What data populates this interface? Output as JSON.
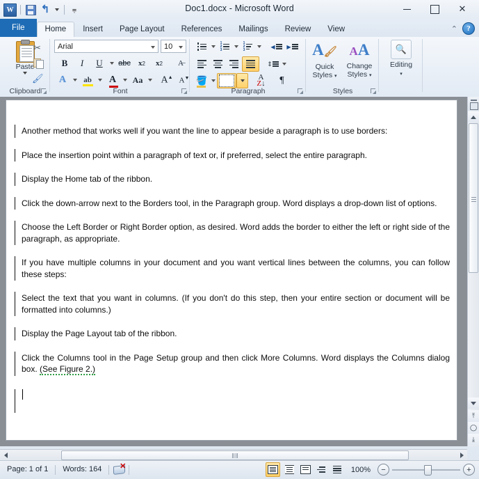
{
  "window": {
    "title": "Doc1.docx  -  Microsoft Word",
    "minimize_label": "Minimize",
    "maximize_label": "Maximize",
    "close_label": "✕"
  },
  "quick_access": {
    "app_logo": "W",
    "items": [
      {
        "name": "save",
        "label": "Save"
      },
      {
        "name": "undo",
        "label": "Undo",
        "glyph": "↰"
      },
      {
        "name": "customize",
        "label": "Customize Quick Access Toolbar"
      }
    ]
  },
  "ribbon": {
    "tabs": [
      {
        "label": "File",
        "active": false,
        "file": true
      },
      {
        "label": "Home",
        "active": true
      },
      {
        "label": "Insert",
        "active": false
      },
      {
        "label": "Page Layout",
        "active": false
      },
      {
        "label": "References",
        "active": false
      },
      {
        "label": "Mailings",
        "active": false
      },
      {
        "label": "Review",
        "active": false
      },
      {
        "label": "View",
        "active": false
      }
    ],
    "minimize_ribbon_icon": "⌃",
    "help_icon": "?",
    "groups": {
      "clipboard": {
        "label": "Clipboard",
        "paste_label": "Paste",
        "buttons": [
          {
            "name": "cut-button",
            "label": "Cut",
            "glyph": "✂"
          },
          {
            "name": "copy-button",
            "label": "Copy"
          },
          {
            "name": "format-painter-button",
            "label": "Format Painter",
            "glyph": "🖌"
          }
        ]
      },
      "font": {
        "label": "Font",
        "font_name": "Arial",
        "font_size": "10",
        "buttons": [
          {
            "name": "bold-button",
            "label": "B"
          },
          {
            "name": "italic-button",
            "label": "I"
          },
          {
            "name": "underline-button",
            "label": "U"
          },
          {
            "name": "strikethrough-button",
            "label": "abc"
          },
          {
            "name": "subscript-button",
            "label": "x"
          },
          {
            "name": "superscript-button",
            "label": "x"
          },
          {
            "name": "clear-formatting-button",
            "label": "A"
          },
          {
            "name": "text-effects-button",
            "label": "A"
          },
          {
            "name": "text-highlight-color-button",
            "label": "ab"
          },
          {
            "name": "font-color-button",
            "label": "A"
          },
          {
            "name": "change-case-button",
            "label": "Aa"
          },
          {
            "name": "grow-font-button",
            "label": "A"
          },
          {
            "name": "shrink-font-button",
            "label": "A"
          }
        ]
      },
      "paragraph": {
        "label": "Paragraph",
        "buttons": [
          {
            "name": "bullets-button",
            "label": "Bullets"
          },
          {
            "name": "numbering-button",
            "label": "Numbering"
          },
          {
            "name": "multilevel-list-button",
            "label": "Multilevel List"
          },
          {
            "name": "decrease-indent-button",
            "label": "Decrease Indent"
          },
          {
            "name": "increase-indent-button",
            "label": "Increase Indent"
          },
          {
            "name": "align-left-button",
            "label": "Align Text Left",
            "active": false
          },
          {
            "name": "align-center-button",
            "label": "Center",
            "active": false
          },
          {
            "name": "align-right-button",
            "label": "Align Text Right",
            "active": false
          },
          {
            "name": "justify-button",
            "label": "Justify",
            "active": true
          },
          {
            "name": "line-spacing-button",
            "label": "Line and Paragraph Spacing"
          },
          {
            "name": "shading-button",
            "label": "Shading"
          },
          {
            "name": "borders-button",
            "label": "Borders",
            "active": true
          },
          {
            "name": "sort-button",
            "label": "Sort"
          },
          {
            "name": "show-marks-button",
            "label": "Show/Hide ¶"
          }
        ]
      },
      "styles": {
        "label": "Styles",
        "quick_styles_label": "Quick\nStyles",
        "quick_styles_line1": "Quick",
        "quick_styles_line2": "Styles",
        "change_styles_line1": "Change",
        "change_styles_line2": "Styles",
        "quick_styles_glyph": "A",
        "change_styles_glyph": "AA"
      },
      "editing": {
        "label": "Editing",
        "editing_label": "Editing",
        "editing_glyph": "🔍"
      }
    }
  },
  "document": {
    "paragraphs": [
      {
        "text": "Another method that works well if you want the line to appear beside a paragraph is to use borders:",
        "justify": false
      },
      {
        "text": "Place the insertion point within a paragraph of text or, if preferred, select the entire paragraph.",
        "justify": false
      },
      {
        "text": "Display the Home tab of the ribbon.",
        "justify": false
      },
      {
        "text": "Click the down-arrow next to the Borders tool, in the Paragraph group. Word displays a drop-down list of options.",
        "justify": true
      },
      {
        "text": "Choose the Left Border or Right Border option, as desired. Word adds the border to either the left or right side of the paragraph, as appropriate.",
        "justify": true
      },
      {
        "text": "If you have multiple columns in your document and you want vertical lines between the columns, you can follow these steps:",
        "justify": true
      },
      {
        "text": "Select the text that you want in columns. (If you don't do this step, then your entire section or document will be formatted into columns.)",
        "justify": true
      },
      {
        "text": "Display the Page Layout tab of the ribbon.",
        "justify": false
      }
    ],
    "last_paragraph": {
      "text_before": "Click the Columns tool in the Page Setup group and then click More Columns. Word displays the Columns dialog box. ",
      "grammar_text": "(See Figure 2.)"
    }
  },
  "status_bar": {
    "page_label": "Page: 1 of 1",
    "word_count_label": "Words: 164",
    "proofing_label": "Proofing errors",
    "zoom_level": "100%",
    "zoom_out_label": "−",
    "zoom_in_label": "+",
    "view_buttons": [
      {
        "name": "print-layout-view-button",
        "label": "Print Layout",
        "active": true
      },
      {
        "name": "full-screen-reading-view-button",
        "label": "Full Screen Reading",
        "active": false
      },
      {
        "name": "web-layout-view-button",
        "label": "Web Layout",
        "active": false
      },
      {
        "name": "outline-view-button",
        "label": "Outline",
        "active": false
      },
      {
        "name": "draft-view-button",
        "label": "Draft",
        "active": false
      }
    ]
  },
  "scrollbars": {
    "split_label": "Split",
    "scroll_up_label": "Scroll Up",
    "scroll_down_label": "Scroll Down",
    "previous_page_label": "Previous Page",
    "select_browse_object_label": "Select Browse Object",
    "next_page_label": "Next Page",
    "scroll_left_label": "Scroll Left",
    "scroll_right_label": "Scroll Right"
  },
  "colors": {
    "accent": "#1e6cb5",
    "highlight": "#ffcf66",
    "grammar_underline": "#2f9e44",
    "page_background": "#8a8f96"
  }
}
